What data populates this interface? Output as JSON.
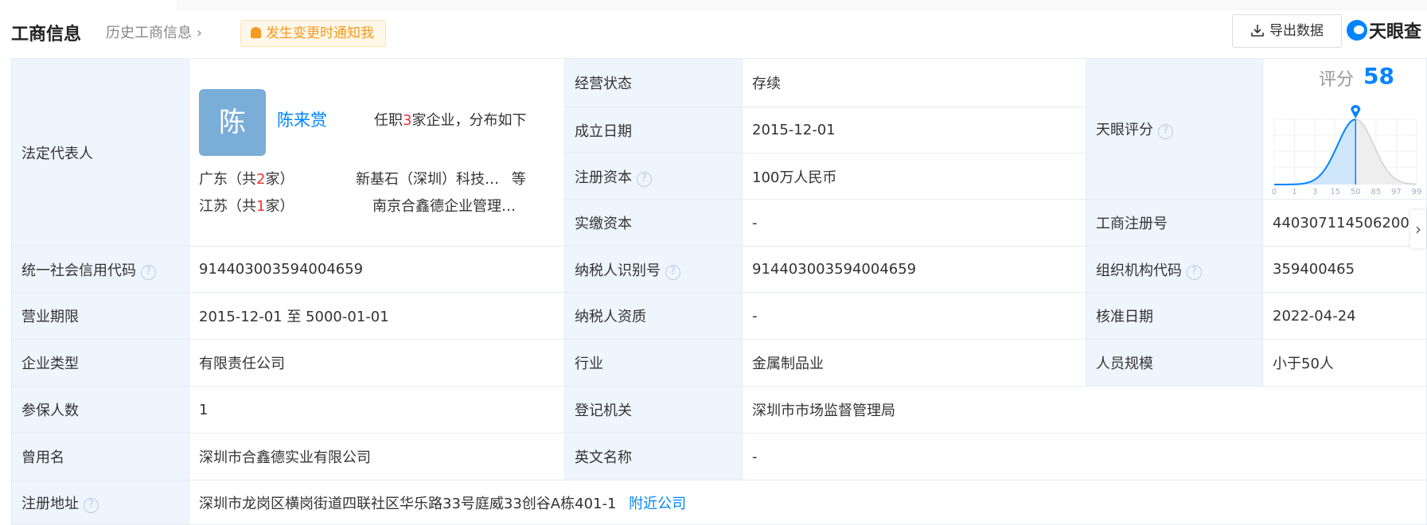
{
  "header": {
    "title": "工商信息",
    "history_link": "历史工商信息",
    "notify_button": "发生变更时通知我",
    "export_button": "导出数据",
    "brand": "天眼查"
  },
  "legal_rep": {
    "label": "法定代表人",
    "avatar_char": "陈",
    "name": "陈来赏",
    "holding_prefix": "任职",
    "holding_count": "3",
    "holding_suffix": "家企业，分布如下",
    "provinces": [
      {
        "name": "广东（共",
        "count": "2",
        "suffix": "家）",
        "company": "新基石（深圳）科技…",
        "more": "等"
      },
      {
        "name": "江苏（共",
        "count": "1",
        "suffix": "家）",
        "company": "南京合鑫德企业管理…",
        "more": ""
      }
    ]
  },
  "fields": {
    "status": {
      "label": "经营状态",
      "value": "存续"
    },
    "founded": {
      "label": "成立日期",
      "value": "2015-12-01"
    },
    "reg_capital": {
      "label": "注册资本",
      "value": "100万人民币"
    },
    "paid_capital": {
      "label": "实缴资本",
      "value": "-"
    },
    "score_label": {
      "label": "天眼评分"
    },
    "reg_no": {
      "label": "工商注册号",
      "value": "440307114506200"
    },
    "credit_code": {
      "label": "统一社会信用代码",
      "value": "914403003594004659"
    },
    "taxpayer_id": {
      "label": "纳税人识别号",
      "value": "914403003594004659"
    },
    "org_code": {
      "label": "组织机构代码",
      "value": "359400465"
    },
    "term": {
      "label": "营业期限",
      "value": "2015-12-01 至 5000-01-01"
    },
    "taxpayer_qual": {
      "label": "纳税人资质",
      "value": "-"
    },
    "approve_date": {
      "label": "核准日期",
      "value": "2022-04-24"
    },
    "company_type": {
      "label": "企业类型",
      "value": "有限责任公司"
    },
    "industry": {
      "label": "行业",
      "value": "金属制品业"
    },
    "staff_size": {
      "label": "人员规模",
      "value": "小于50人"
    },
    "insured": {
      "label": "参保人数",
      "value": "1"
    },
    "authority": {
      "label": "登记机关",
      "value": "深圳市市场监督管理局"
    },
    "former_name": {
      "label": "曾用名",
      "value": "深圳市合鑫德实业有限公司"
    },
    "english_name": {
      "label": "英文名称",
      "value": "-"
    },
    "address": {
      "label": "注册地址",
      "value": "深圳市龙岗区横岗街道四联社区华乐路33号庭威33创谷A栋401-1",
      "nearby": "附近公司"
    }
  },
  "score": {
    "title": "评分",
    "value": "58",
    "percentile_position": 50,
    "ticks": [
      "0",
      "1",
      "3",
      "15",
      "50",
      "85",
      "97",
      "99"
    ],
    "accent": "#0084ff"
  }
}
